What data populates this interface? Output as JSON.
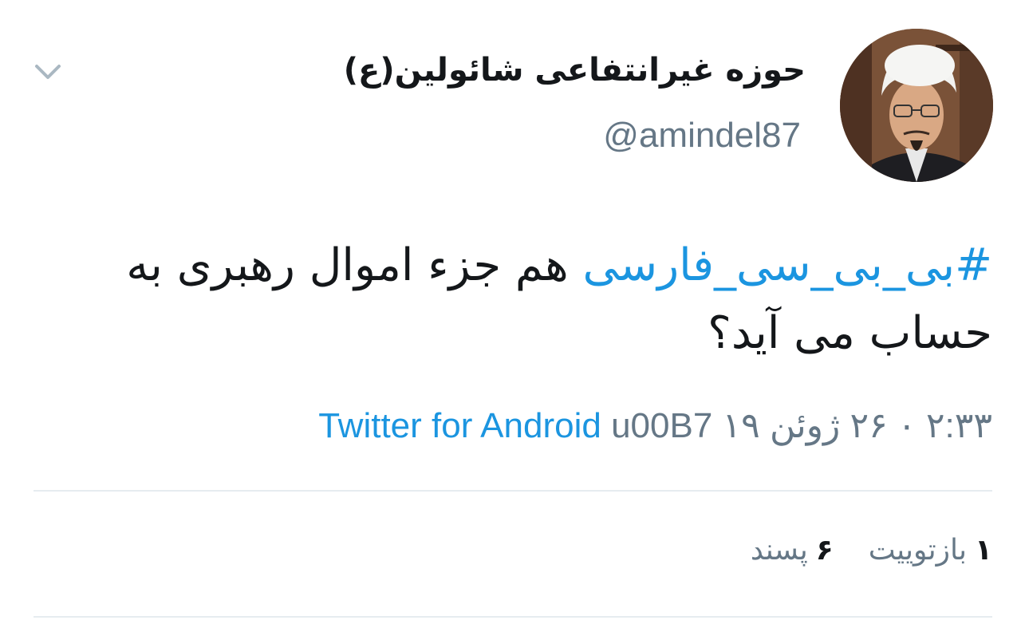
{
  "author": {
    "display_name": "حوزه غیرانتفاعی شائولین(ع)",
    "handle": "@amindel87"
  },
  "tweet": {
    "hashtag": "#بی_بی_سی_فارسی",
    "text_rest": " هم جزء اموال رهبری به حساب می آید؟"
  },
  "meta": {
    "time": "۲:۳۳",
    "separator": "۰",
    "date": "۲۶ ژوئن ۱۹",
    "source": "Twitter for Android",
    "dot_code": "u00B7"
  },
  "stats": {
    "retweets_count": "۱",
    "retweets_label": "بازتوییت",
    "likes_count": "۶",
    "likes_label": "پسند"
  },
  "icons": {
    "menu": "chevron-down-icon"
  },
  "colors": {
    "link": "#1b95e0",
    "secondary_text": "#657786",
    "primary_text": "#14171a",
    "divider": "#e6ecf0"
  }
}
